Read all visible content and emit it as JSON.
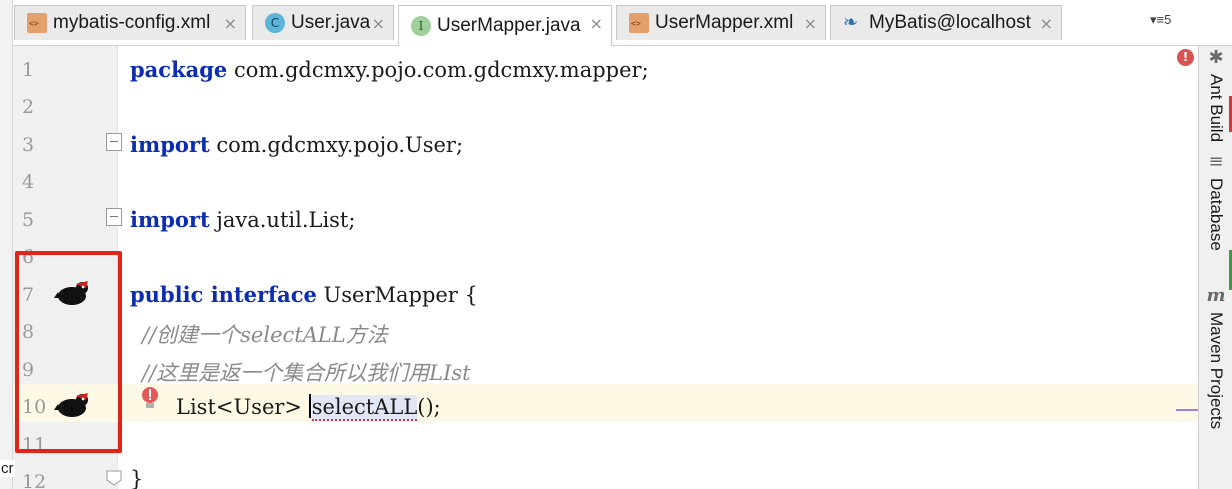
{
  "tabs": [
    {
      "label": "mybatis-config.xml",
      "icon": "xml-file-icon",
      "active": false
    },
    {
      "label": "User.java",
      "icon": "class-icon",
      "active": false
    },
    {
      "label": "UserMapper.java",
      "icon": "interface-icon",
      "active": true
    },
    {
      "label": "UserMapper.xml",
      "icon": "xml-file-icon",
      "active": false
    },
    {
      "label": "MyBatis@localhost",
      "icon": "database-icon",
      "active": false
    }
  ],
  "tab_close_glyph": "×",
  "tab_overflow": {
    "label": "▾≡",
    "count": "5"
  },
  "icon_glyphs": {
    "class": "C",
    "interface": "I",
    "database": "❧"
  },
  "right_tools": [
    {
      "label": "Ant Build",
      "icon": "ant-icon"
    },
    {
      "label": "Database",
      "icon": "database-icon"
    },
    {
      "label": "Maven Projects",
      "icon": "maven-icon"
    }
  ],
  "right_tool_glyphs": {
    "ant": "✱",
    "database": "≡",
    "maven": "m"
  },
  "editor": {
    "lines": [
      {
        "no": "1",
        "kw": "package",
        "text": " com.gdcmxy.pojo.com.gdcmxy.mapper;"
      },
      {
        "no": "2",
        "kw": "",
        "text": ""
      },
      {
        "no": "3",
        "kw": "import",
        "text": " com.gdcmxy.pojo.User;"
      },
      {
        "no": "4",
        "kw": "",
        "text": ""
      },
      {
        "no": "5",
        "kw": "import",
        "text": " java.util.List;"
      },
      {
        "no": "6",
        "kw": "",
        "text": ""
      },
      {
        "no": "7",
        "kw": "public interface",
        "text": " UserMapper {"
      },
      {
        "no": "8",
        "comment": "//创建一个selectALL方法"
      },
      {
        "no": "9",
        "comment": "//这里是返一个集合所以我们用LIst"
      },
      {
        "no": "10",
        "pre": "List<User> ",
        "method": "selectALL",
        "post": "();"
      },
      {
        "no": "11",
        "kw": "",
        "text": ""
      },
      {
        "no": "12",
        "kw": "",
        "text": "}"
      }
    ]
  },
  "error_badge": "!",
  "left_cut_text": "cr",
  "colors": {
    "keyword": "#0b2db1",
    "comment": "#8a8a8a",
    "highlight_box": "#e22418",
    "caret_row": "#fdf9e4"
  }
}
